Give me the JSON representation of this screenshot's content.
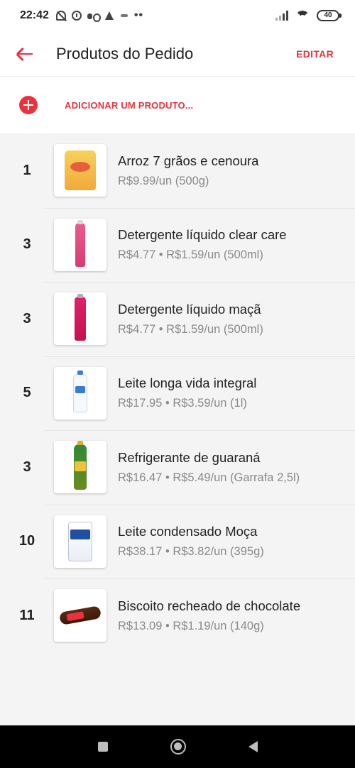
{
  "status_bar": {
    "time": "22:42",
    "battery": "40",
    "dots": "••"
  },
  "header": {
    "title": "Produtos do Pedido",
    "edit_label": "EDITAR"
  },
  "add_product": {
    "label": "ADICIONAR UM PRODUTO..."
  },
  "products": [
    {
      "qty": "1",
      "name": "Arroz 7 grãos e cenoura",
      "price": "R$9.99/un (500g)",
      "image": "rice-package"
    },
    {
      "qty": "3",
      "name": "Detergente líquido clear care",
      "price": "R$4.77 • R$1.59/un (500ml)",
      "image": "pink-detergent-bottle"
    },
    {
      "qty": "3",
      "name": "Detergente líquido maçã",
      "price": "R$4.77 • R$1.59/un (500ml)",
      "image": "magenta-detergent-bottle"
    },
    {
      "qty": "5",
      "name": "Leite longa vida integral",
      "price": "R$17.95 • R$3.59/un (1l)",
      "image": "milk-bottle"
    },
    {
      "qty": "3",
      "name": "Refrigerante de guaraná",
      "price": "R$16.47 • R$5.49/un (Garrafa 2,5l)",
      "image": "soda-bottle"
    },
    {
      "qty": "10",
      "name": "Leite condensado Moça",
      "price": "R$38.17 • R$3.82/un (395g)",
      "image": "condensed-milk-can"
    },
    {
      "qty": "11",
      "name": "Biscoito recheado de chocolate",
      "price": "R$13.09 • R$1.19/un (140g)",
      "image": "cookie-package"
    }
  ],
  "colors": {
    "accent": "#e8333f",
    "background": "#f4f4f4",
    "price_text": "#8a8a8a"
  }
}
